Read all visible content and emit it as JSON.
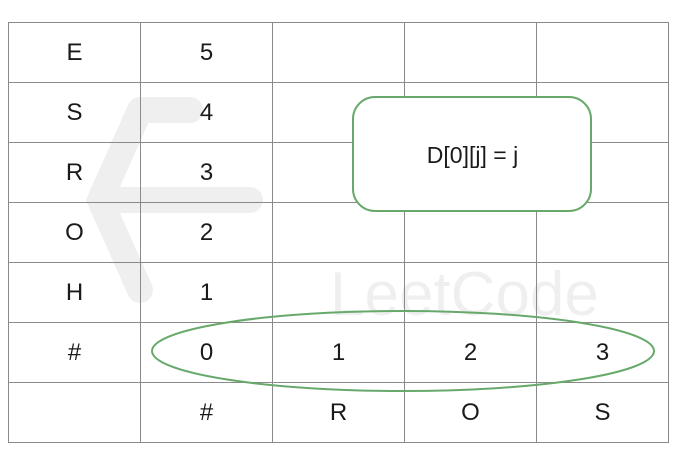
{
  "table": {
    "rows": [
      [
        "E",
        "5",
        "",
        "",
        ""
      ],
      [
        "S",
        "4",
        "",
        "",
        ""
      ],
      [
        "R",
        "3",
        "",
        "",
        ""
      ],
      [
        "O",
        "2",
        "",
        "",
        ""
      ],
      [
        "H",
        "1",
        "",
        "",
        ""
      ],
      [
        "#",
        "0",
        "1",
        "2",
        "3"
      ],
      [
        "",
        "#",
        "R",
        "O",
        "S"
      ]
    ]
  },
  "callout": {
    "text": "D[0][j] = j",
    "border_color": "#67a96b"
  },
  "highlight_color": "#67a96b",
  "watermark": {
    "text": "LeetCode",
    "icon": "leetcode-logo-icon"
  }
}
